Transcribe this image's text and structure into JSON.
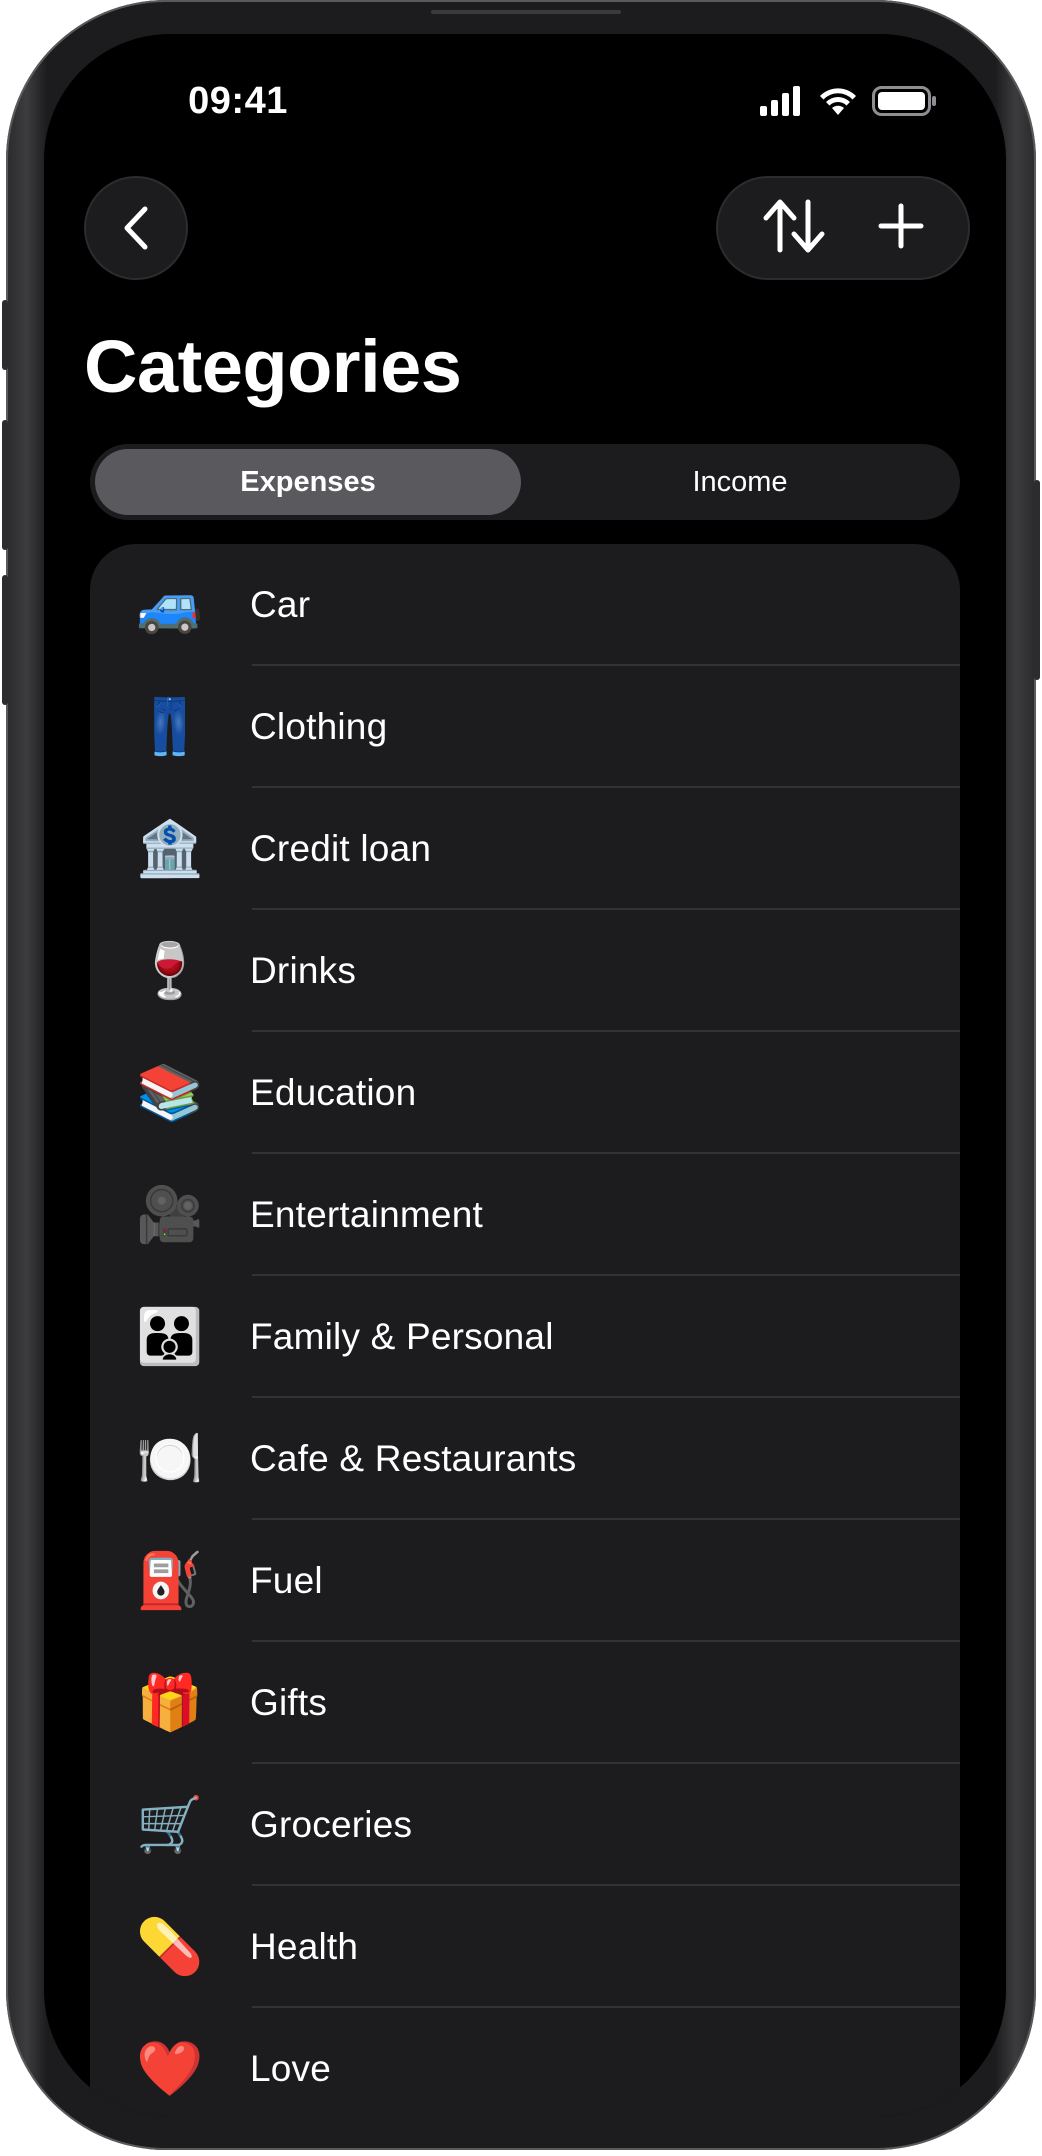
{
  "status_bar": {
    "time": "09:41"
  },
  "nav": {
    "back_icon": "chevron-left-icon",
    "sort_icon": "sort-arrows-icon",
    "add_icon": "plus-icon"
  },
  "page": {
    "title": "Categories"
  },
  "segmented": {
    "options": [
      "Expenses",
      "Income"
    ],
    "selected": "Expenses"
  },
  "categories": [
    {
      "icon": "🚙",
      "label": "Car"
    },
    {
      "icon": "👖",
      "label": "Clothing"
    },
    {
      "icon": "🏦",
      "label": "Credit loan"
    },
    {
      "icon": "🍷",
      "label": "Drinks"
    },
    {
      "icon": "📚",
      "label": "Education"
    },
    {
      "icon": "🎥",
      "label": "Entertainment"
    },
    {
      "icon": "👪",
      "label": "Family & Personal"
    },
    {
      "icon": "🍽️",
      "label": "Cafe & Restaurants"
    },
    {
      "icon": "⛽",
      "label": "Fuel"
    },
    {
      "icon": "🎁",
      "label": "Gifts"
    },
    {
      "icon": "🛒",
      "label": "Groceries"
    },
    {
      "icon": "💊",
      "label": "Health"
    },
    {
      "icon": "❤️",
      "label": "Love"
    }
  ],
  "colors": {
    "background": "#000000",
    "card": "#1c1c1e",
    "segment_active": "#5a5a5e",
    "text": "#ffffff",
    "separator": "#333335"
  }
}
